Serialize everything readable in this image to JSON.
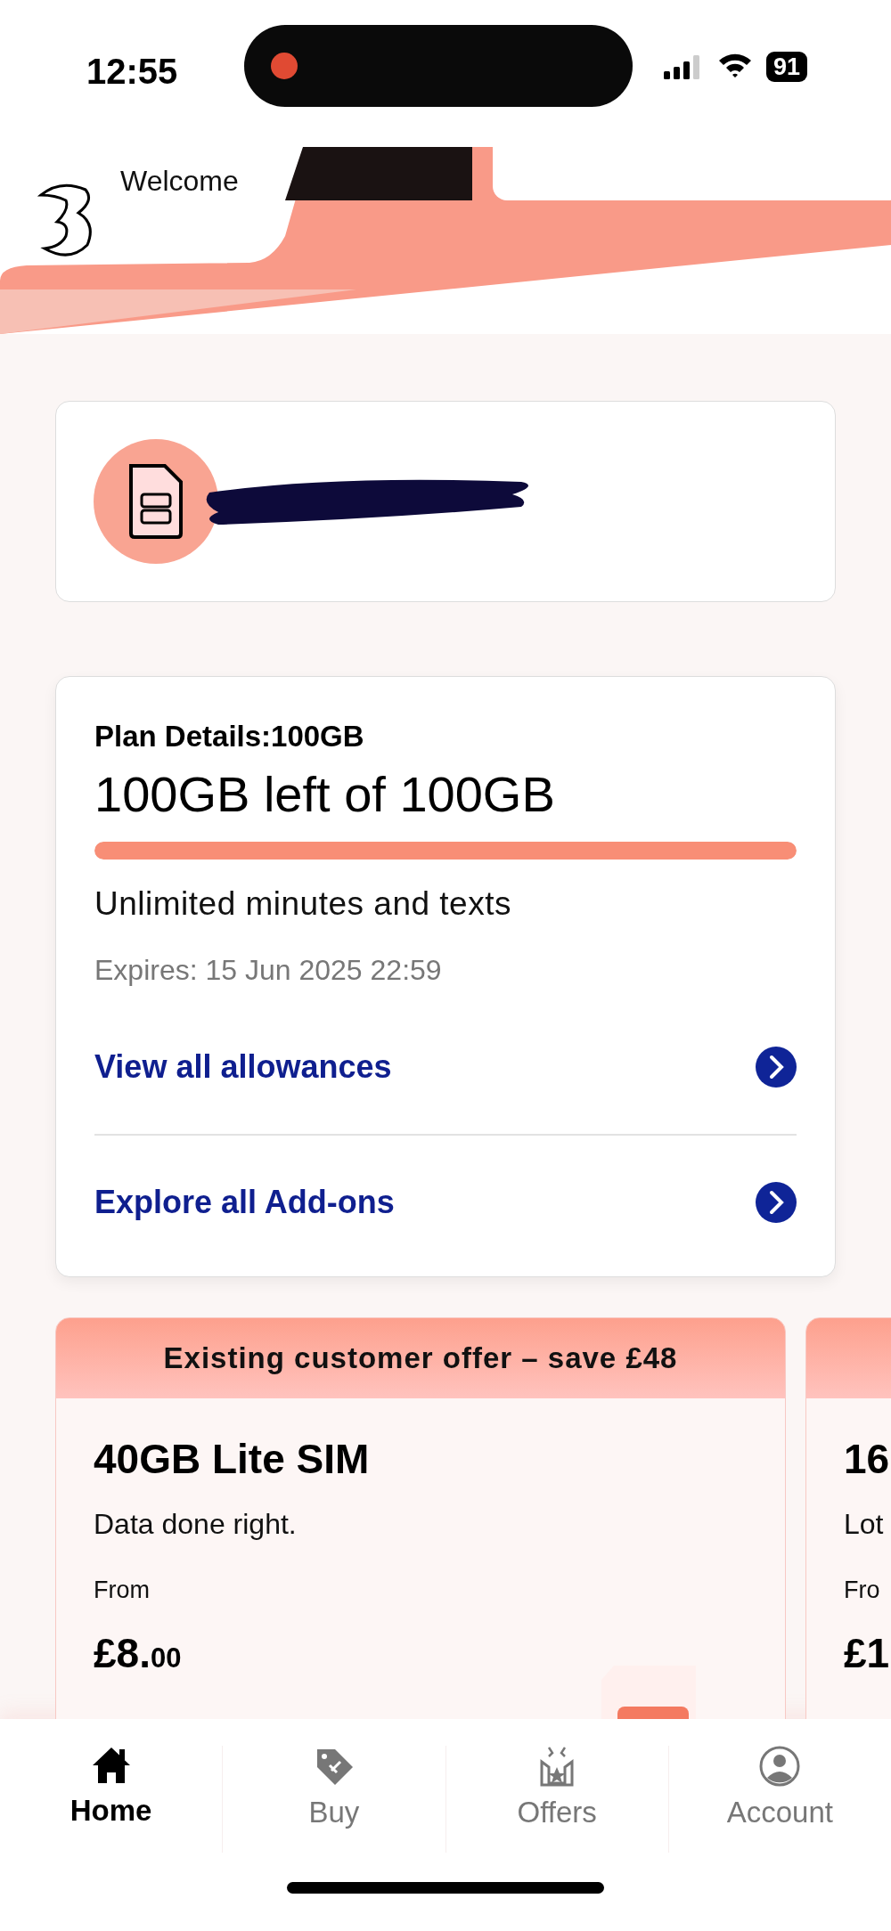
{
  "status_bar": {
    "time": "12:55",
    "battery": "91",
    "recording": true
  },
  "header": {
    "greeting": "Welcome"
  },
  "plan": {
    "title": "Plan Details:100GB",
    "remaining": "100GB left of 100GB",
    "level": 1,
    "included": "Unlimited minutes and texts",
    "expiry": "Expires: 15 Jun 2025 22:59",
    "links": [
      {
        "label": "View all allowances"
      },
      {
        "label": "Explore all Add-ons"
      }
    ]
  },
  "offers": [
    {
      "banner": "Existing customer offer – save £48",
      "title": "40GB Lite SIM",
      "description": "Data done right.",
      "from": "From",
      "price_major": "£8.",
      "price_minor": "00"
    },
    {
      "title": "16",
      "description": "Lot",
      "from": "Fro",
      "price_major": "£1"
    }
  ],
  "tab_bar": [
    {
      "kind": "home",
      "label": "Home",
      "selected": true
    },
    {
      "kind": "buy",
      "label": "Buy",
      "selected": false
    },
    {
      "kind": "offers",
      "label": "Offers",
      "selected": false
    },
    {
      "kind": "account",
      "label": "Account",
      "selected": false
    }
  ]
}
